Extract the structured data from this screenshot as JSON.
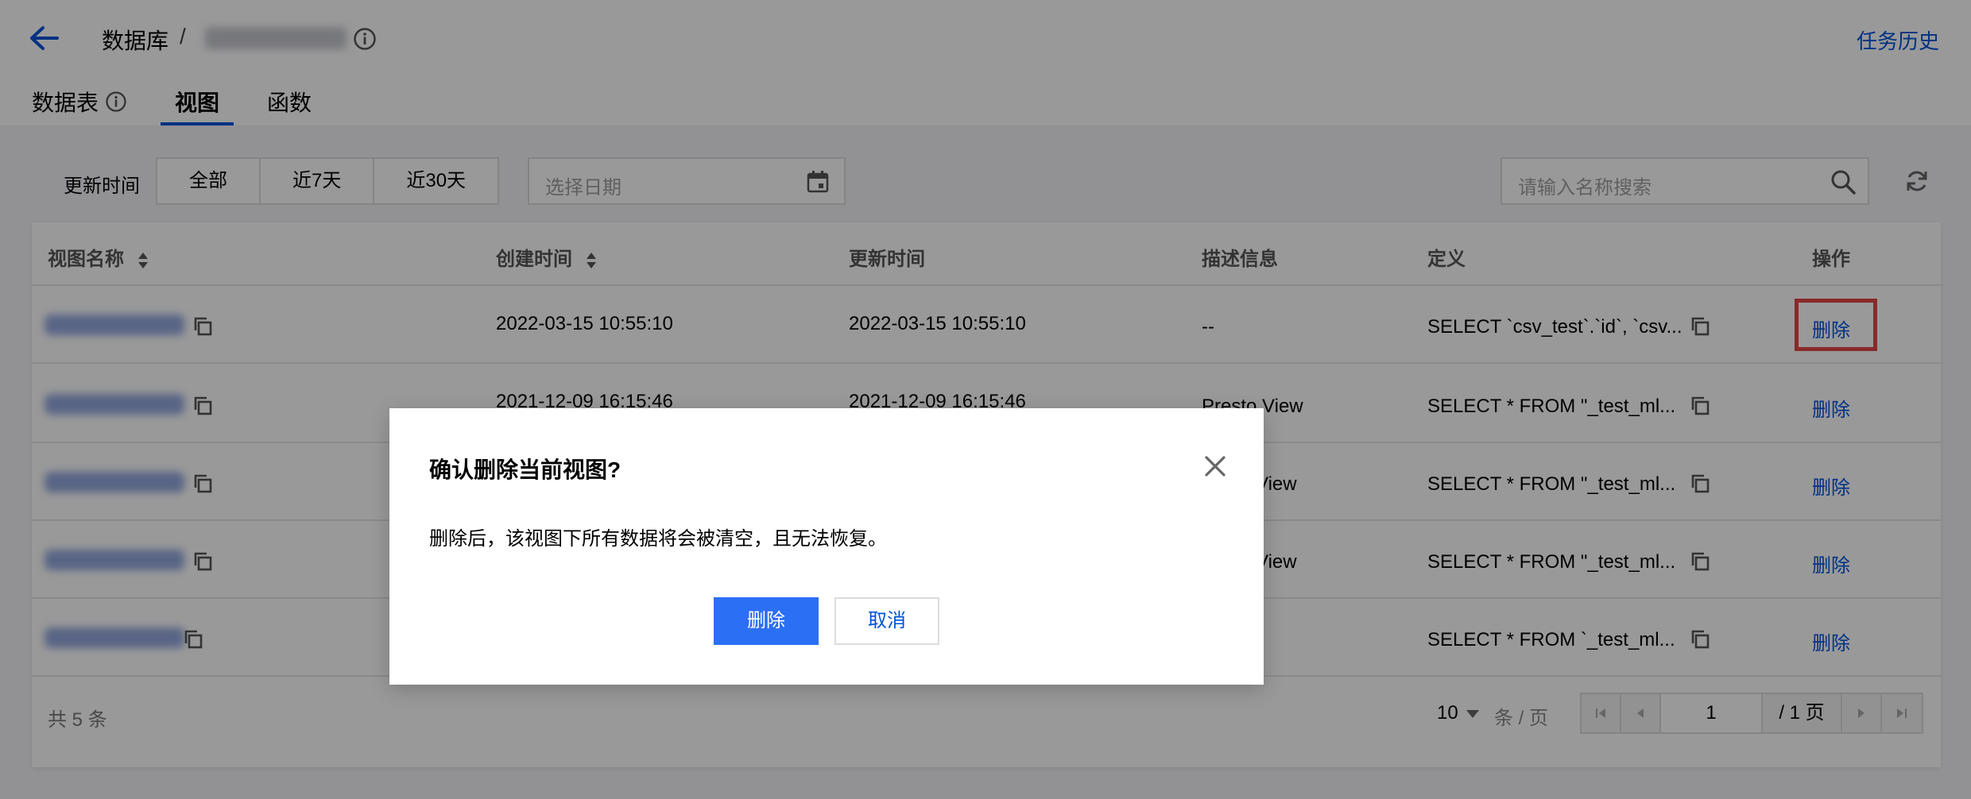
{
  "header": {
    "breadcrumb_db": "数据库",
    "breadcrumb_sep": "/",
    "task_history": "任务历史"
  },
  "tabs": [
    {
      "label": "数据表",
      "active": false
    },
    {
      "label": "视图",
      "active": true
    },
    {
      "label": "函数",
      "active": false
    }
  ],
  "filters": {
    "label": "更新时间",
    "ranges": [
      "全部",
      "近7天",
      "近30天"
    ],
    "date_placeholder": "选择日期",
    "search_placeholder": "请输入名称搜索"
  },
  "table": {
    "columns": [
      "视图名称",
      "创建时间",
      "更新时间",
      "描述信息",
      "定义",
      "操作"
    ],
    "rows": [
      {
        "created": "2022-03-15 10:55:10",
        "updated": "2022-03-15 10:55:10",
        "desc": "--",
        "definition": "SELECT `csv_test`.`id`, `csv...",
        "op": "删除"
      },
      {
        "created": "2021-12-09 16:15:46",
        "updated": "2021-12-09 16:15:46",
        "desc": "Presto View",
        "definition": "SELECT * FROM \"_test_ml...",
        "op": "删除"
      },
      {
        "created": "",
        "updated": "",
        "desc": "View",
        "definition": "SELECT * FROM \"_test_ml...",
        "op": "删除"
      },
      {
        "created": "",
        "updated": "",
        "desc": "View",
        "definition": "SELECT * FROM \"_test_ml...",
        "op": "删除"
      },
      {
        "created": "",
        "updated": "",
        "desc": "",
        "definition": "SELECT * FROM `_test_ml...",
        "op": "删除"
      }
    ]
  },
  "footer": {
    "total": "共 5 条",
    "page_size": "10",
    "per_page": "条 / 页",
    "current_page": "1",
    "total_pages": "/ 1 页"
  },
  "modal": {
    "title": "确认删除当前视图?",
    "body": "删除后，该视图下所有数据将会被清空，且无法恢复。",
    "confirm": "删除",
    "cancel": "取消"
  },
  "colors": {
    "accent": "#0052d9",
    "primary_button": "#2b6ff5",
    "highlight": "#e54545"
  }
}
